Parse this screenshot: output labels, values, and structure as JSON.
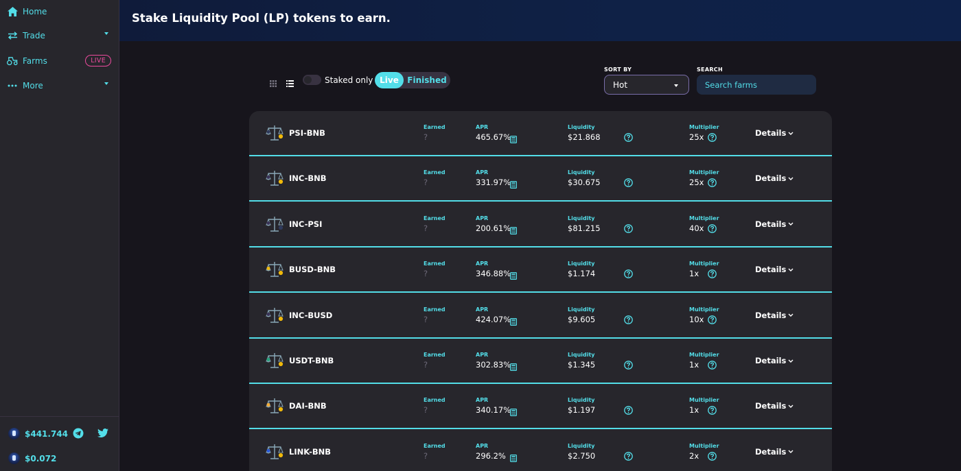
{
  "sidebar": {
    "items": [
      {
        "label": "Home",
        "icon": "home-icon"
      },
      {
        "label": "Trade",
        "icon": "swap-arrows-icon",
        "dropdown": true
      },
      {
        "label": "Farms",
        "icon": "tractor-icon",
        "badge": "LIVE"
      },
      {
        "label": "More",
        "icon": "more-dots-icon",
        "dropdown": true
      }
    ],
    "footer": {
      "tvl": "$441.744",
      "price": "$0.072",
      "socials": [
        "telegram-icon",
        "twitter-icon"
      ]
    }
  },
  "header": {
    "title": "Stake Liquidity Pool (LP) tokens to earn."
  },
  "controls": {
    "view_modes": [
      "grid-view-icon",
      "list-view-icon"
    ],
    "staked_only_label": "Staked only",
    "staked_only": false,
    "tabs": [
      "Live",
      "Finished"
    ],
    "active_tab": "Live",
    "sort_by_label": "SORT BY",
    "sort_value": "Hot",
    "search_label": "SEARCH",
    "search_placeholder": "Search farms"
  },
  "columns": {
    "earned": "Earned",
    "apr": "APR",
    "liquidity": "Liquidity",
    "multiplier": "Multiplier",
    "details": "Details"
  },
  "farms": [
    {
      "pair": "PSI-BNB",
      "earned": "?",
      "apr": "465.67%",
      "liquidity": "$21.868",
      "multiplier": "25x"
    },
    {
      "pair": "INC-BNB",
      "earned": "?",
      "apr": "331.97%",
      "liquidity": "$30.675",
      "multiplier": "25x"
    },
    {
      "pair": "INC-PSI",
      "earned": "?",
      "apr": "200.61%",
      "liquidity": "$81.215",
      "multiplier": "40x"
    },
    {
      "pair": "BUSD-BNB",
      "earned": "?",
      "apr": "346.88%",
      "liquidity": "$1.174",
      "multiplier": "1x"
    },
    {
      "pair": "INC-BUSD",
      "earned": "?",
      "apr": "424.07%",
      "liquidity": "$9.605",
      "multiplier": "10x"
    },
    {
      "pair": "USDT-BNB",
      "earned": "?",
      "apr": "302.83%",
      "liquidity": "$1.345",
      "multiplier": "1x"
    },
    {
      "pair": "DAI-BNB",
      "earned": "?",
      "apr": "340.17%",
      "liquidity": "$1.197",
      "multiplier": "1x"
    },
    {
      "pair": "LINK-BNB",
      "earned": "?",
      "apr": "296.2%",
      "liquidity": "$2.750",
      "multiplier": "2x"
    }
  ],
  "colors": {
    "accent": "#53dee9",
    "badge": "#ed4b9e",
    "card": "#27262c",
    "background": "#17151c"
  }
}
